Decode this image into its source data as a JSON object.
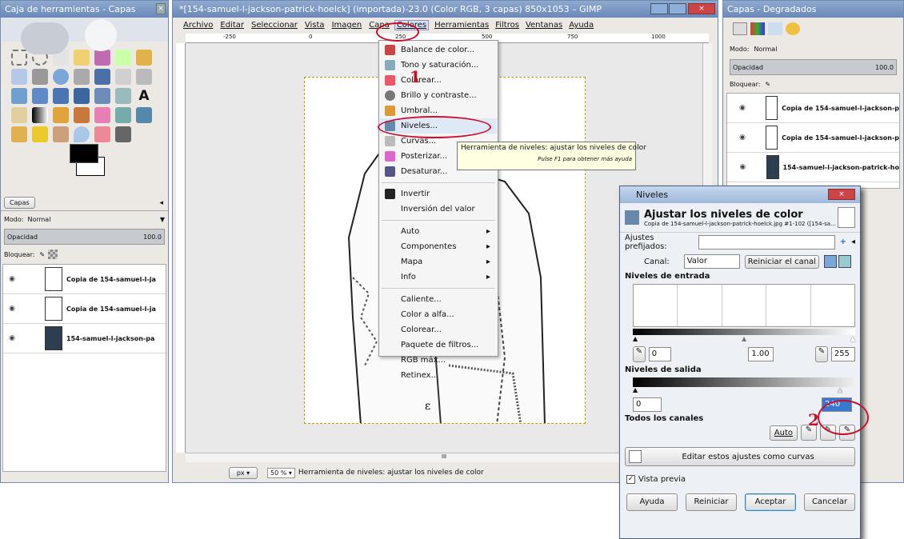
{
  "toolbox": {
    "title": "Caja de herramientas - Capas",
    "layers_tab": "Capas",
    "mode_label": "Modo:",
    "mode_value": "Normal",
    "opacity_label": "Opacidad",
    "opacity_value": "100.0",
    "lock_label": "Bloquear:",
    "layers": [
      {
        "name": "Copia de 154-samuel-l-ja"
      },
      {
        "name": "Copia de 154-samuel-l-ja"
      },
      {
        "name": "154-samuel-l-jackson-pa"
      }
    ]
  },
  "main": {
    "title": "*[154-samuel-l-jackson-patrick-hoelck] (importada)-23.0 (Color RGB, 3 capas) 850x1053 – GIMP",
    "menubar": [
      "Archivo",
      "Editar",
      "Seleccionar",
      "Vista",
      "Imagen",
      "Capa",
      "Colores",
      "Herramientas",
      "Filtros",
      "Ventanas",
      "Ayuda"
    ],
    "ruler_marks": [
      "-250",
      "0",
      "250",
      "500",
      "750",
      "1000"
    ],
    "unit": "px",
    "zoom": "50 %",
    "status": "Herramienta de niveles: ajustar los niveles de color",
    "hscroll_mark": "III"
  },
  "colors_menu": {
    "items": [
      "Balance de color...",
      "Tono y saturación...",
      "Colorear...",
      "Brillo y contraste...",
      "Umbral...",
      "Niveles...",
      "Curvas...",
      "Posterizar...",
      "Desaturar..."
    ],
    "items2": [
      "Invertir",
      "Inversión del valor"
    ],
    "items3": [
      "Auto",
      "Componentes",
      "Mapa",
      "Info"
    ],
    "items4": [
      "Caliente...",
      "Color a alfa...",
      "Colorear...",
      "Paquete de filtros...",
      "RGB máx...",
      "Retinex..."
    ]
  },
  "tooltip": {
    "text": "Herramienta de niveles: ajustar los niveles de color",
    "hint": "Pulse F1 para obtener más ayuda"
  },
  "right_panel": {
    "title": "Capas - Degradados",
    "mode_label": "Modo:",
    "mode_value": "Normal",
    "opacity_label": "Opacidad",
    "opacity_value": "100.0",
    "lock_label": "Bloquear:",
    "layers": [
      {
        "name": "Copia de 154-samuel-l-jackson-p"
      },
      {
        "name": "Copia de 154-samuel-l-jackson-p"
      },
      {
        "name": "154-samuel-l-jackson-patrick-ho"
      }
    ]
  },
  "levels": {
    "title": "Niveles",
    "heading": "Ajustar los niveles de color",
    "subheading": "Copia de 154-samuel-l-jackson-patrick-hoelck.jpg #1-102 ([154-sa...",
    "presets_label": "Ajustes prefijados:",
    "channel_label": "Canal:",
    "channel_value": "Valor",
    "reset_channel": "Reiniciar el canal",
    "input_heading": "Niveles de entrada",
    "input_low": "0",
    "input_gamma": "1.00",
    "input_high": "255",
    "output_heading": "Niveles de salida",
    "output_low": "0",
    "output_high": "240",
    "all_channels": "Todos los canales",
    "auto": "Auto",
    "edit_curves": "Editar estos ajustes como curvas",
    "preview": "Vista previa",
    "help": "Ayuda",
    "reset": "Reiniciar",
    "accept": "Aceptar",
    "cancel": "Cancelar"
  },
  "annotations": {
    "step1": "1",
    "step2": "2"
  }
}
